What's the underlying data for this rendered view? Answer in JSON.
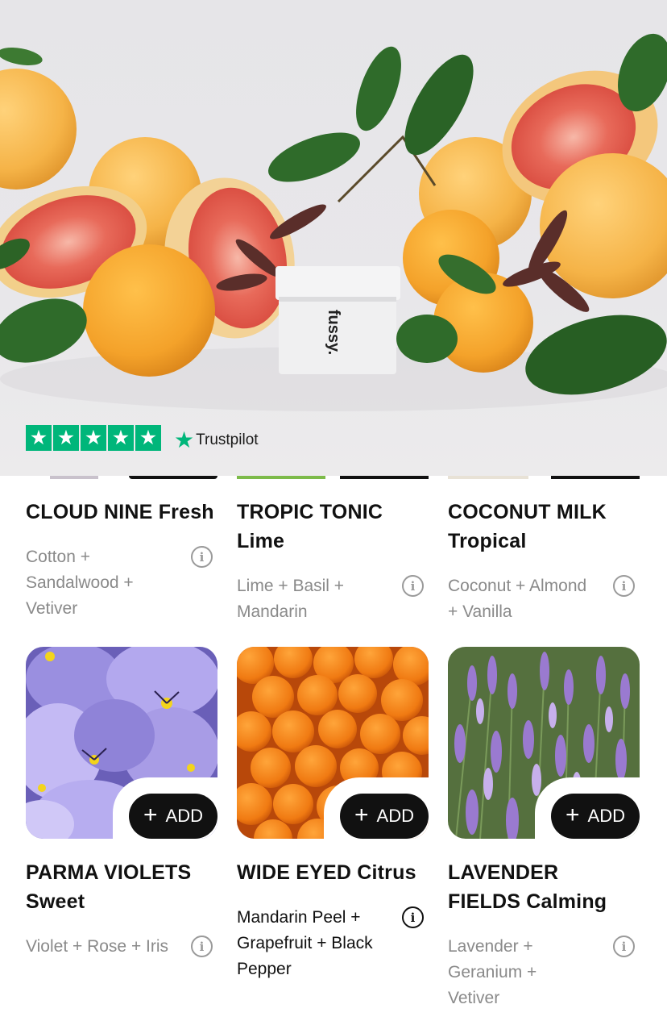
{
  "trustpilot": {
    "brand": "Trustpilot",
    "stars": 5,
    "star_glyph": "★",
    "color": "#00b67a"
  },
  "hero": {
    "jar_label": "fussy."
  },
  "products_top": [
    {
      "title": "CLOUD NINE Fresh",
      "notes": "Cotton + Sandalwood + Vetiver"
    },
    {
      "title": "TROPIC TONIC Lime",
      "notes": "Lime + Basil + Mandarin"
    },
    {
      "title": "COCONUT MILK Tropical",
      "notes": "Coconut + Almond + Vanilla"
    }
  ],
  "products_bottom": [
    {
      "title": "PARMA VIOLETS Sweet",
      "notes": "Violet + Rose + Iris",
      "image": "violets-photo"
    },
    {
      "title": "WIDE EYED Citrus",
      "notes": "Mandarin Peel + Grapefruit + Black Pepper",
      "image": "oranges-photo"
    },
    {
      "title": "LAVENDER FIELDS Calming",
      "notes": "Lavender + Geranium + Vetiver",
      "image": "lavender-photo"
    }
  ],
  "add_label": "ADD",
  "add_icon": "+",
  "info_icon": "i"
}
